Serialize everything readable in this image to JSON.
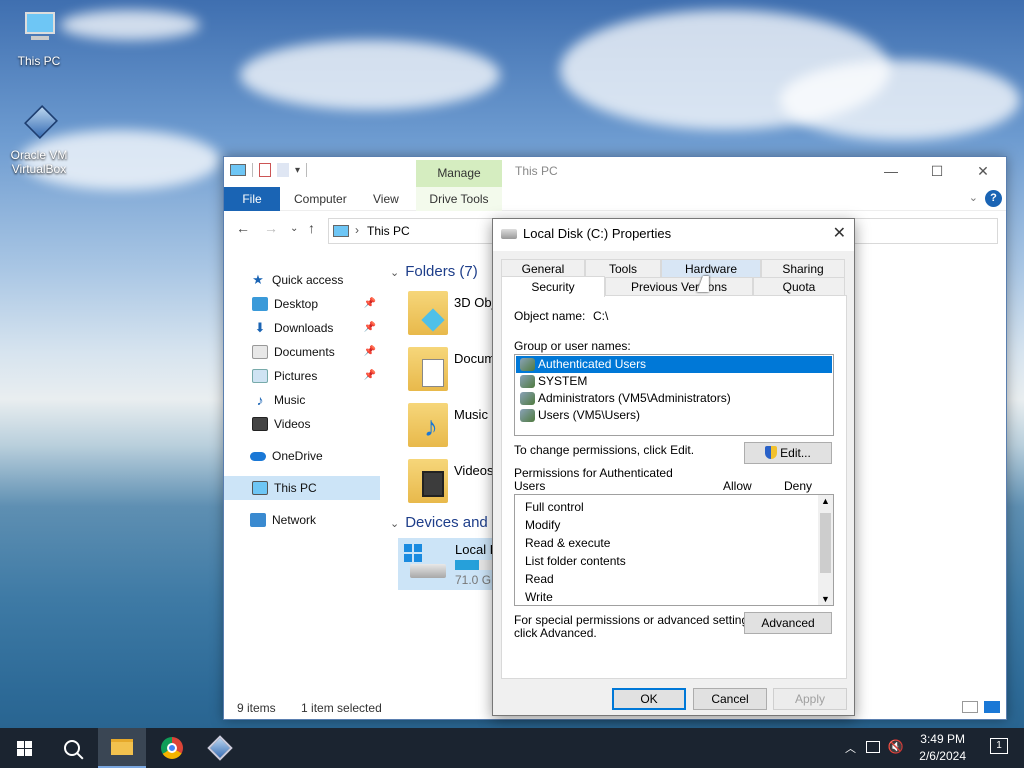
{
  "desktop": {
    "icons": [
      {
        "label": "This PC"
      },
      {
        "label": "Oracle VM VirtualBox"
      }
    ]
  },
  "explorer": {
    "title": "This PC",
    "manage_tab": "Manage",
    "ribbon_tabs": [
      "File",
      "Computer",
      "View",
      "Drive Tools"
    ],
    "address": "This PC",
    "nav": {
      "quick_access": "Quick access",
      "items": [
        "Desktop",
        "Downloads",
        "Documents",
        "Pictures",
        "Music",
        "Videos"
      ],
      "onedrive": "OneDrive",
      "this_pc": "This PC",
      "network": "Network"
    },
    "folders_header": "Folders (7)",
    "folders": [
      "3D Obje",
      "Docum",
      "Music",
      "Videos"
    ],
    "devices_header": "Devices and d",
    "drive": {
      "name": "Local D",
      "free": "71.0 GB",
      "used_fraction": 0.45
    },
    "status_items": "9 items",
    "status_selected": "1 item selected"
  },
  "dialog": {
    "title": "Local Disk (C:) Properties",
    "tabs_row1": [
      "General",
      "Tools",
      "Hardware",
      "Sharing"
    ],
    "tabs_row2": [
      "Security",
      "Previous Versions",
      "Quota"
    ],
    "object_name_label": "Object name:",
    "object_name_value": "C:\\",
    "group_label": "Group or user names:",
    "users": [
      "Authenticated Users",
      "SYSTEM",
      "Administrators (VM5\\Administrators)",
      "Users (VM5\\Users)"
    ],
    "change_text": "To change permissions, click Edit.",
    "edit_button": "Edit...",
    "perm_label_1": "Permissions for Authenticated",
    "perm_label_2": "Users",
    "allow": "Allow",
    "deny": "Deny",
    "permissions": [
      "Full control",
      "Modify",
      "Read & execute",
      "List folder contents",
      "Read",
      "Write"
    ],
    "special_text_1": "For special permissions or advanced settings,",
    "special_text_2": "click Advanced.",
    "advanced_button": "Advanced",
    "ok": "OK",
    "cancel": "Cancel",
    "apply": "Apply"
  },
  "taskbar": {
    "time": "3:49 PM",
    "date": "2/6/2024",
    "notification_count": "1"
  }
}
